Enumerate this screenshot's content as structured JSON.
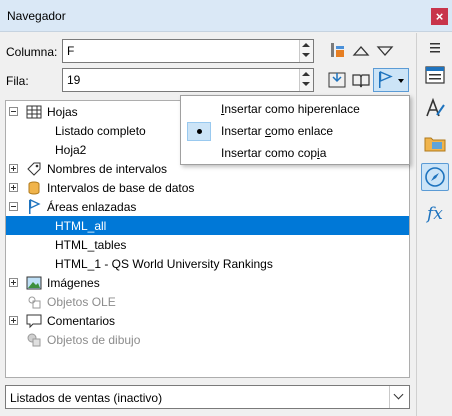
{
  "window": {
    "title": "Navegador",
    "close_label": "×"
  },
  "column": {
    "label": "Columna:",
    "value": "F"
  },
  "row": {
    "label": "Fila:",
    "value": "19"
  },
  "tree": {
    "items": [
      {
        "label": "Hojas",
        "icon": "sheets-icon"
      },
      {
        "label": "Listado completo"
      },
      {
        "label": "Hoja2"
      },
      {
        "label": "Nombres de intervalos",
        "icon": "range-names-icon"
      },
      {
        "label": "Intervalos de base de datos",
        "icon": "database-icon"
      },
      {
        "label": "Áreas enlazadas",
        "icon": "linked-area-icon"
      },
      {
        "label": "HTML_all",
        "selected": true
      },
      {
        "label": "HTML_tables"
      },
      {
        "label": "HTML_1 - QS World University Rankings"
      },
      {
        "label": "Imágenes",
        "icon": "images-icon"
      },
      {
        "label": "Objetos OLE",
        "icon": "ole-objects-icon",
        "disabled": true
      },
      {
        "label": "Comentarios",
        "icon": "comments-icon"
      },
      {
        "label": "Objetos de dibujo",
        "icon": "drawing-objects-icon",
        "disabled": true
      }
    ]
  },
  "document_select": {
    "value": "Listados de ventas (inactivo)"
  },
  "drag_mode_menu": {
    "items": [
      {
        "pre": "",
        "ul": "I",
        "post": "nsertar como hiperenlace",
        "checked": false
      },
      {
        "pre": "Insertar ",
        "ul": "c",
        "post": "omo enlace",
        "checked": true
      },
      {
        "pre": "Insertar como cop",
        "ul": "i",
        "post": "a",
        "checked": false
      }
    ]
  },
  "colors": {
    "selection": "#0078d7",
    "titlebar": "#dae8f6",
    "close": "#c8344b",
    "accent": "#1e73be"
  }
}
